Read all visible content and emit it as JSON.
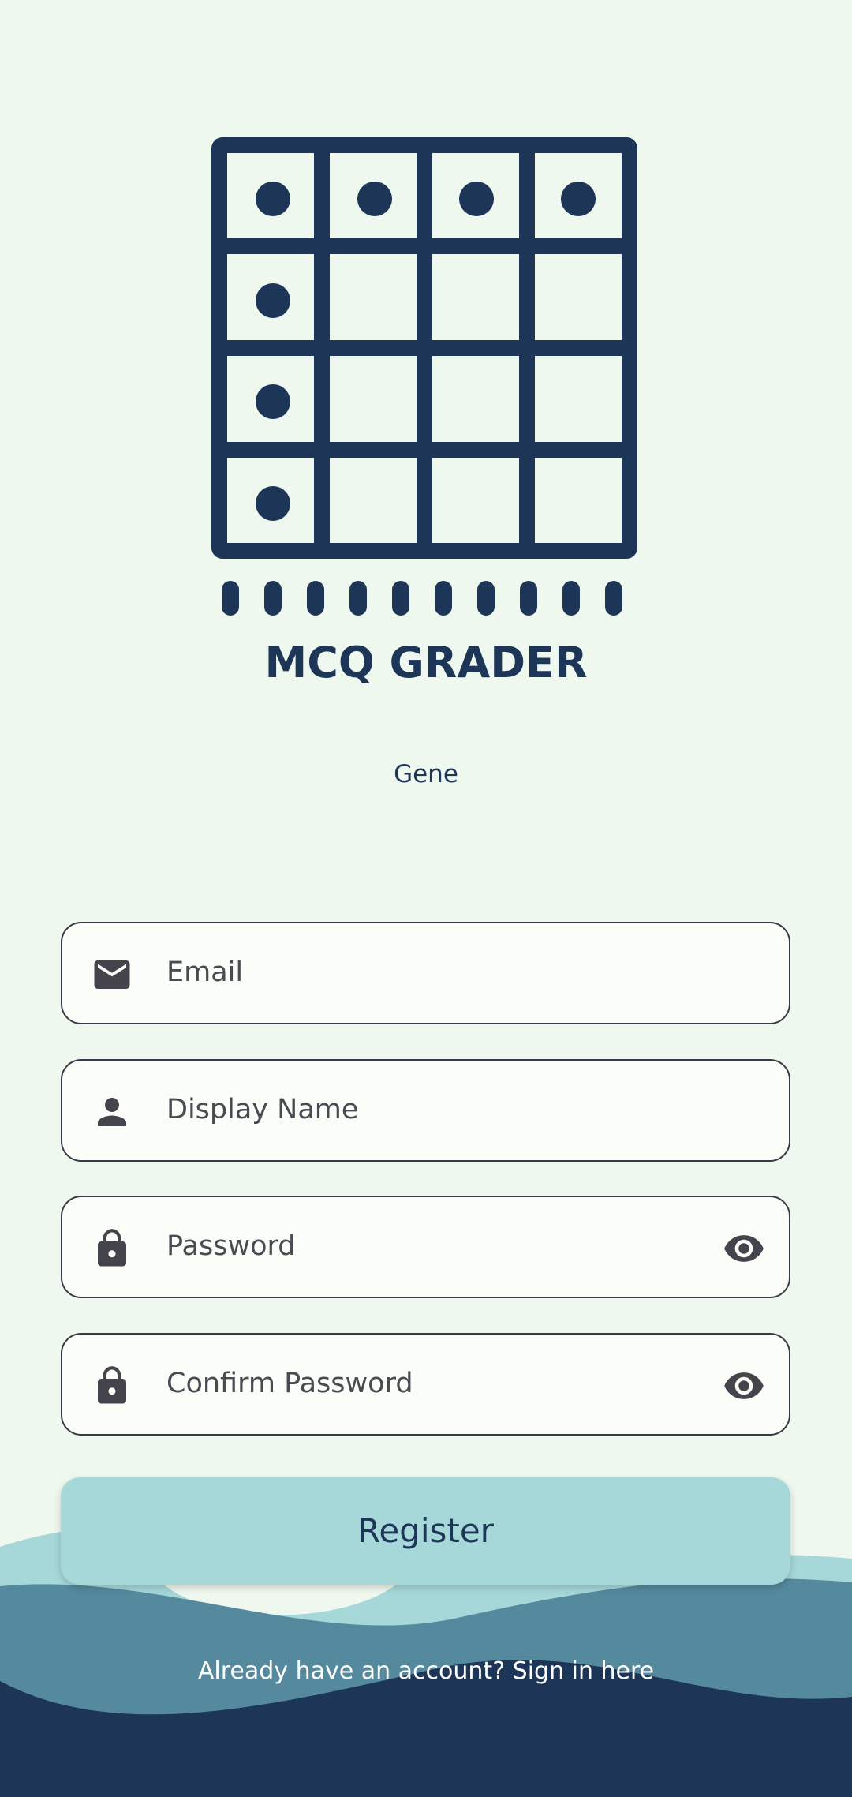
{
  "app": {
    "title": "MCQ GRADER",
    "subtitle": "Gene"
  },
  "form": {
    "email_placeholder": "Email",
    "display_name_placeholder": "Display Name",
    "password_placeholder": "Password",
    "confirm_password_placeholder": "Confirm Password",
    "icons": {
      "email": "envelope-icon",
      "display_name": "person-icon",
      "password": "lock-icon",
      "confirm_password": "lock-icon",
      "visibility": "eye-icon"
    }
  },
  "actions": {
    "register_label": "Register",
    "signin_prompt": "Already have an account? Sign in here"
  },
  "colors": {
    "background": "#eff8ef",
    "primary": "#1d3557",
    "button": "#a6d8da",
    "wave_light": "#a6d8da",
    "wave_mid": "#558a9e",
    "wave_dark": "#1d3557"
  }
}
